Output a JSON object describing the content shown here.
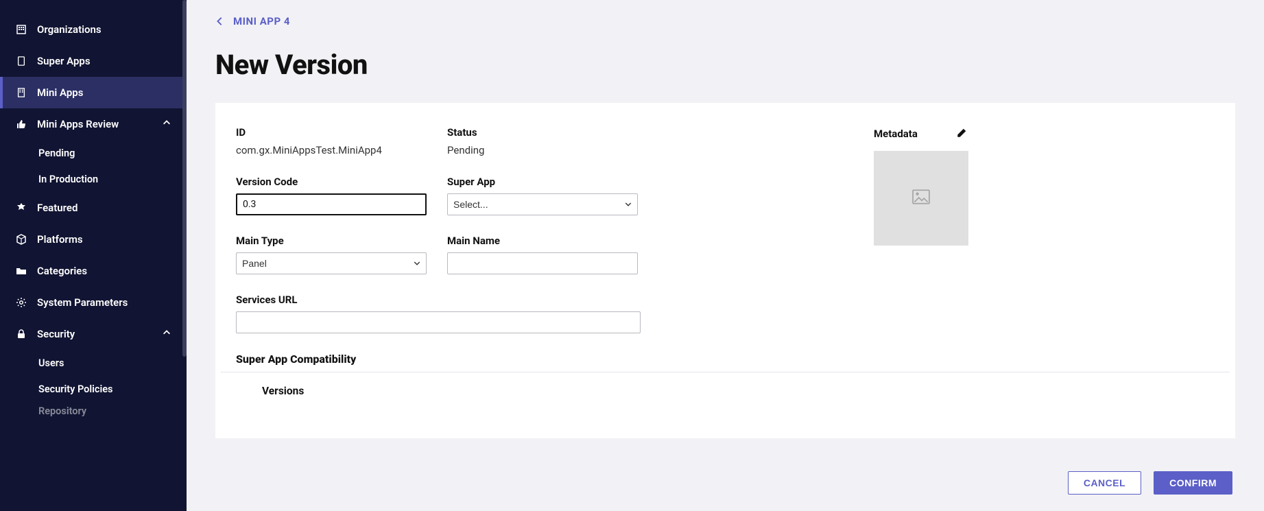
{
  "sidebar": {
    "items": [
      {
        "label": "Organizations"
      },
      {
        "label": "Super Apps"
      },
      {
        "label": "Mini Apps"
      },
      {
        "label": "Mini Apps Review"
      },
      {
        "label": "Featured"
      },
      {
        "label": "Platforms"
      },
      {
        "label": "Categories"
      },
      {
        "label": "System Parameters"
      },
      {
        "label": "Security"
      }
    ],
    "review_children": [
      {
        "label": "Pending"
      },
      {
        "label": "In Production"
      }
    ],
    "security_children": [
      {
        "label": "Users"
      },
      {
        "label": "Security Policies"
      },
      {
        "label": "Repository"
      }
    ]
  },
  "breadcrumb": {
    "parent": "MINI APP 4"
  },
  "page": {
    "title": "New Version"
  },
  "form": {
    "id_label": "ID",
    "id_value": "com.gx.MiniAppsTest.MiniApp4",
    "status_label": "Status",
    "status_value": "Pending",
    "version_code_label": "Version Code",
    "version_code_value": "0.3",
    "super_app_label": "Super App",
    "super_app_placeholder": "Select...",
    "main_type_label": "Main Type",
    "main_type_value": "Panel",
    "main_name_label": "Main Name",
    "main_name_value": "",
    "services_url_label": "Services URL",
    "services_url_value": "",
    "metadata_label": "Metadata",
    "compat_title": "Super App Compatibility",
    "versions_title": "Versions"
  },
  "actions": {
    "cancel": "CANCEL",
    "confirm": "CONFIRM"
  }
}
